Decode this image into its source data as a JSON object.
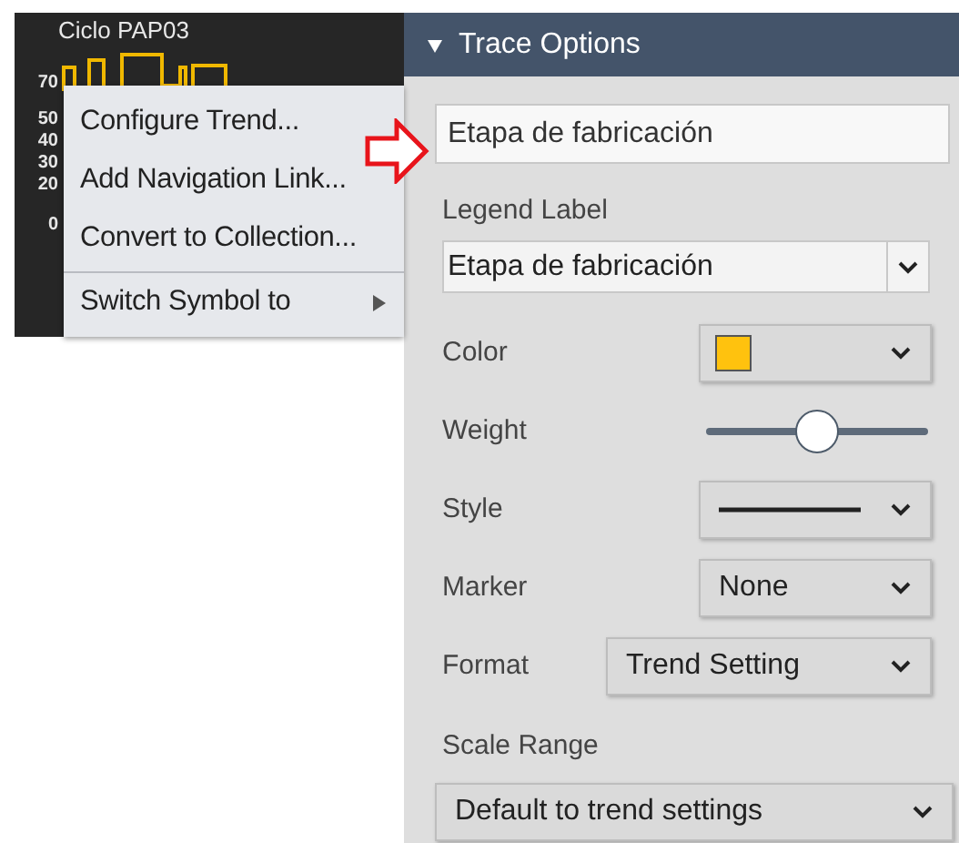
{
  "trend": {
    "title": "Ciclo PAP03",
    "y_axis_labels": [
      "70",
      "50",
      "40",
      "30",
      "20",
      "0"
    ]
  },
  "context_menu": {
    "items": [
      {
        "label": "Configure Trend...",
        "kind": "action",
        "separator_before": false
      },
      {
        "label": "Add Navigation Link...",
        "kind": "action",
        "separator_before": false
      },
      {
        "label": "Convert to Collection...",
        "kind": "action",
        "separator_before": false
      },
      {
        "label": "Switch Symbol to",
        "kind": "submenu",
        "separator_before": true
      }
    ]
  },
  "trace_options": {
    "title": "Trace Options",
    "expanded": true,
    "name": {
      "value": "Etapa de fabricación"
    },
    "legend_label": {
      "label": "Legend Label",
      "value": "Etapa de fabricación"
    },
    "rows": [
      {
        "kind": "color",
        "label": "Color",
        "color": "#ffc20e"
      },
      {
        "kind": "slider",
        "label": "Weight",
        "level": 0.5
      },
      {
        "kind": "line",
        "label": "Style"
      },
      {
        "kind": "select",
        "label": "Marker",
        "value": "None"
      },
      {
        "kind": "wideselect",
        "label": "Format",
        "value": "Trend Setting"
      }
    ],
    "scale_range": {
      "label": "Scale Range",
      "value": "Default to trend settings"
    }
  }
}
